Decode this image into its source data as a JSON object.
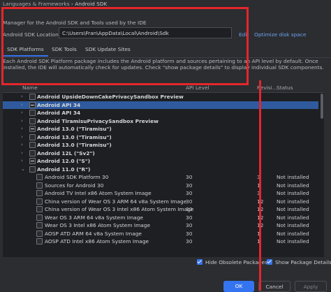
{
  "breadcrumb": {
    "parent": "Languages & Frameworks",
    "separator": "›",
    "current": "Android SDK"
  },
  "description": "Manager for the Android SDK and Tools used by the IDE",
  "location": {
    "label": "Android SDK Location:",
    "value": "C:\\Users\\Fran\\AppData\\Local\\Android\\Sdk",
    "edit": "Edit",
    "optimize": "Optimize disk space"
  },
  "tabs": [
    {
      "label": "SDK Platforms",
      "active": true
    },
    {
      "label": "SDK Tools",
      "active": false
    },
    {
      "label": "SDK Update Sites",
      "active": false
    }
  ],
  "info": "Each Android SDK Platform package includes the Android platform and sources pertaining to an API level by default. Once installed, the IDE will automatically check for updates. Check \"show package details\" to display individual SDK components.",
  "columns": {
    "name": "Name",
    "api": "API Level",
    "revision": "Revisi...",
    "status": "Status"
  },
  "rows": [
    {
      "name": "Android UpsideDownCakePrivacySandbox Preview",
      "level": 0,
      "arrow": "›",
      "check": "empty",
      "selected": false,
      "api": "",
      "rev": "",
      "status": ""
    },
    {
      "name": "Android API 34",
      "level": 0,
      "arrow": "›",
      "check": "dash",
      "selected": true,
      "api": "",
      "rev": "",
      "status": ""
    },
    {
      "name": "Android API 34",
      "level": 0,
      "arrow": "›",
      "check": "empty",
      "selected": false,
      "api": "",
      "rev": "",
      "status": ""
    },
    {
      "name": "Android TiramisuPrivacySandbox Preview",
      "level": 0,
      "arrow": "›",
      "check": "empty",
      "selected": false,
      "api": "",
      "rev": "",
      "status": ""
    },
    {
      "name": "Android 13.0 (\"Tiramisu\")",
      "level": 0,
      "arrow": "›",
      "check": "dash",
      "selected": false,
      "api": "",
      "rev": "",
      "status": ""
    },
    {
      "name": "Android 13.0 (\"Tiramisu\")",
      "level": 0,
      "arrow": "›",
      "check": "empty",
      "selected": false,
      "api": "",
      "rev": "",
      "status": ""
    },
    {
      "name": "Android 13.0 (\"Tiramisu\")",
      "level": 0,
      "arrow": "›",
      "check": "empty",
      "selected": false,
      "api": "",
      "rev": "",
      "status": ""
    },
    {
      "name": "Android 12L (\"Sv2\")",
      "level": 0,
      "arrow": "›",
      "check": "empty",
      "selected": false,
      "api": "",
      "rev": "",
      "status": ""
    },
    {
      "name": "Android 12.0 (\"S\")",
      "level": 0,
      "arrow": "›",
      "check": "dash",
      "selected": false,
      "api": "",
      "rev": "",
      "status": ""
    },
    {
      "name": "Android 11.0 (\"R\")",
      "level": 0,
      "arrow": "⌄",
      "check": "empty",
      "selected": false,
      "api": "",
      "rev": "",
      "status": ""
    },
    {
      "name": "Android SDK Platform 30",
      "level": 1,
      "arrow": "",
      "check": "empty",
      "selected": false,
      "api": "30",
      "rev": "3",
      "status": "Not installed"
    },
    {
      "name": "Sources for Android 30",
      "level": 1,
      "arrow": "",
      "check": "empty",
      "selected": false,
      "api": "30",
      "rev": "1",
      "status": "Not installed"
    },
    {
      "name": "Android TV Intel x86 Atom System Image",
      "level": 1,
      "arrow": "",
      "check": "empty",
      "selected": false,
      "api": "30",
      "rev": "3",
      "status": "Not installed"
    },
    {
      "name": "China version of Wear OS 3 ARM 64 v8a System Image",
      "level": 1,
      "arrow": "",
      "check": "empty",
      "selected": false,
      "api": "30",
      "rev": "12",
      "status": "Not installed"
    },
    {
      "name": "China version of Wear OS 3 Intel x86 Atom System Image",
      "level": 1,
      "arrow": "",
      "check": "empty",
      "selected": false,
      "api": "30",
      "rev": "12",
      "status": "Not installed"
    },
    {
      "name": "Wear OS 3 ARM 64 v8a System Image",
      "level": 1,
      "arrow": "",
      "check": "empty",
      "selected": false,
      "api": "30",
      "rev": "12",
      "status": "Not installed"
    },
    {
      "name": "Wear OS 3 Intel x86 Atom System Image",
      "level": 1,
      "arrow": "",
      "check": "empty",
      "selected": false,
      "api": "30",
      "rev": "12",
      "status": "Not installed"
    },
    {
      "name": "AOSP ATD ARM 64 v8a System Image",
      "level": 1,
      "arrow": "",
      "check": "empty",
      "selected": false,
      "api": "30",
      "rev": "1",
      "status": "Not installed"
    },
    {
      "name": "AOSP ATD Intel x86 Atom System Image",
      "level": 1,
      "arrow": "",
      "check": "empty",
      "selected": false,
      "api": "30",
      "rev": "1",
      "status": "Not installed"
    }
  ],
  "options": {
    "hide_obsolete": "Hide Obsolete Packages",
    "show_details": "Show Package Details"
  },
  "buttons": {
    "ok": "OK",
    "cancel": "Cancel",
    "apply": "Apply"
  },
  "colors": {
    "accent": "#3574f0",
    "highlight": "#e5262b",
    "selection": "#2f5a9e"
  }
}
